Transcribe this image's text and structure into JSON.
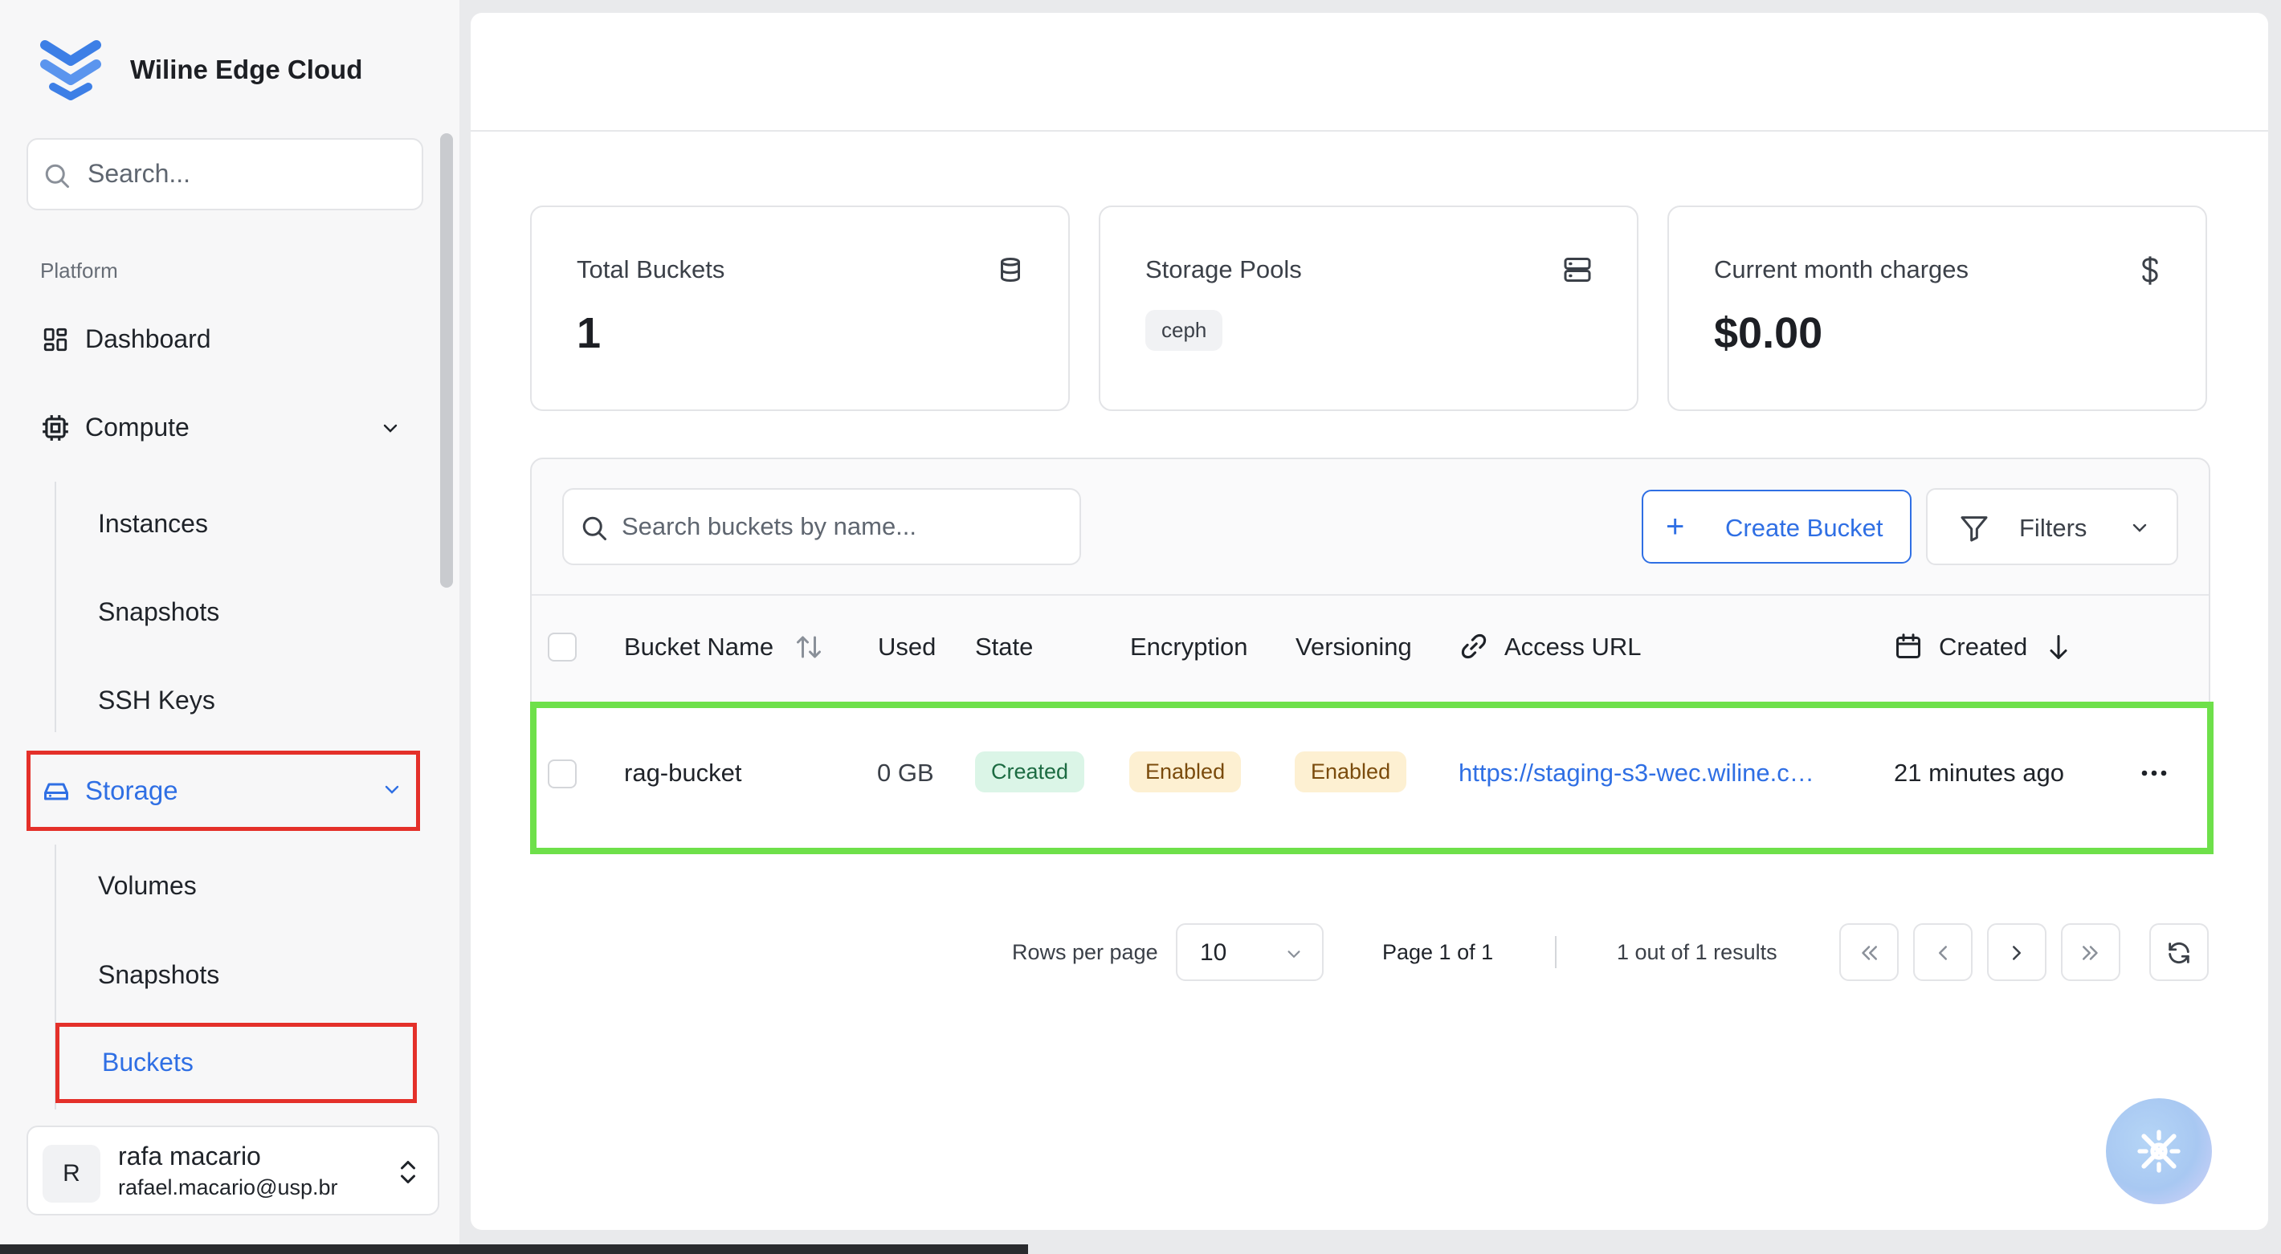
{
  "app": {
    "brand": "Wiline Edge Cloud"
  },
  "sidebar": {
    "search_placeholder": "Search...",
    "section_label": "Platform",
    "items": {
      "dashboard": "Dashboard",
      "compute": "Compute",
      "compute_sub": [
        "Instances",
        "Snapshots",
        "SSH Keys"
      ],
      "storage": "Storage",
      "storage_sub": [
        "Volumes",
        "Snapshots",
        "Buckets"
      ]
    },
    "user": {
      "initial": "R",
      "name": "rafa macario",
      "email": "rafael.macario@usp.br"
    }
  },
  "cards": {
    "total_buckets": {
      "title": "Total Buckets",
      "value": "1"
    },
    "storage_pools": {
      "title": "Storage Pools",
      "chip": "ceph"
    },
    "charges": {
      "title": "Current month charges",
      "value": "$0.00"
    }
  },
  "table": {
    "search_placeholder": "Search buckets by name...",
    "create_label": "Create Bucket",
    "filters_label": "Filters",
    "headers": {
      "name": "Bucket Name",
      "used": "Used",
      "state": "State",
      "encryption": "Encryption",
      "versioning": "Versioning",
      "access_url": "Access URL",
      "created": "Created"
    },
    "rows": [
      {
        "name": "rag-bucket",
        "used": "0 GB",
        "state": "Created",
        "encryption": "Enabled",
        "versioning": "Enabled",
        "access_url": "https://staging-s3-wec.wiline.c…",
        "created": "21 minutes ago"
      }
    ]
  },
  "pagination": {
    "rows_per_page_label": "Rows per page",
    "rows_per_page_value": "10",
    "page_label": "Page 1 of 1",
    "results_label": "1 out of 1 results"
  },
  "colors": {
    "accent": "#2f6fe4",
    "highlight_red": "#e4302a",
    "highlight_green": "#6ee04a"
  }
}
